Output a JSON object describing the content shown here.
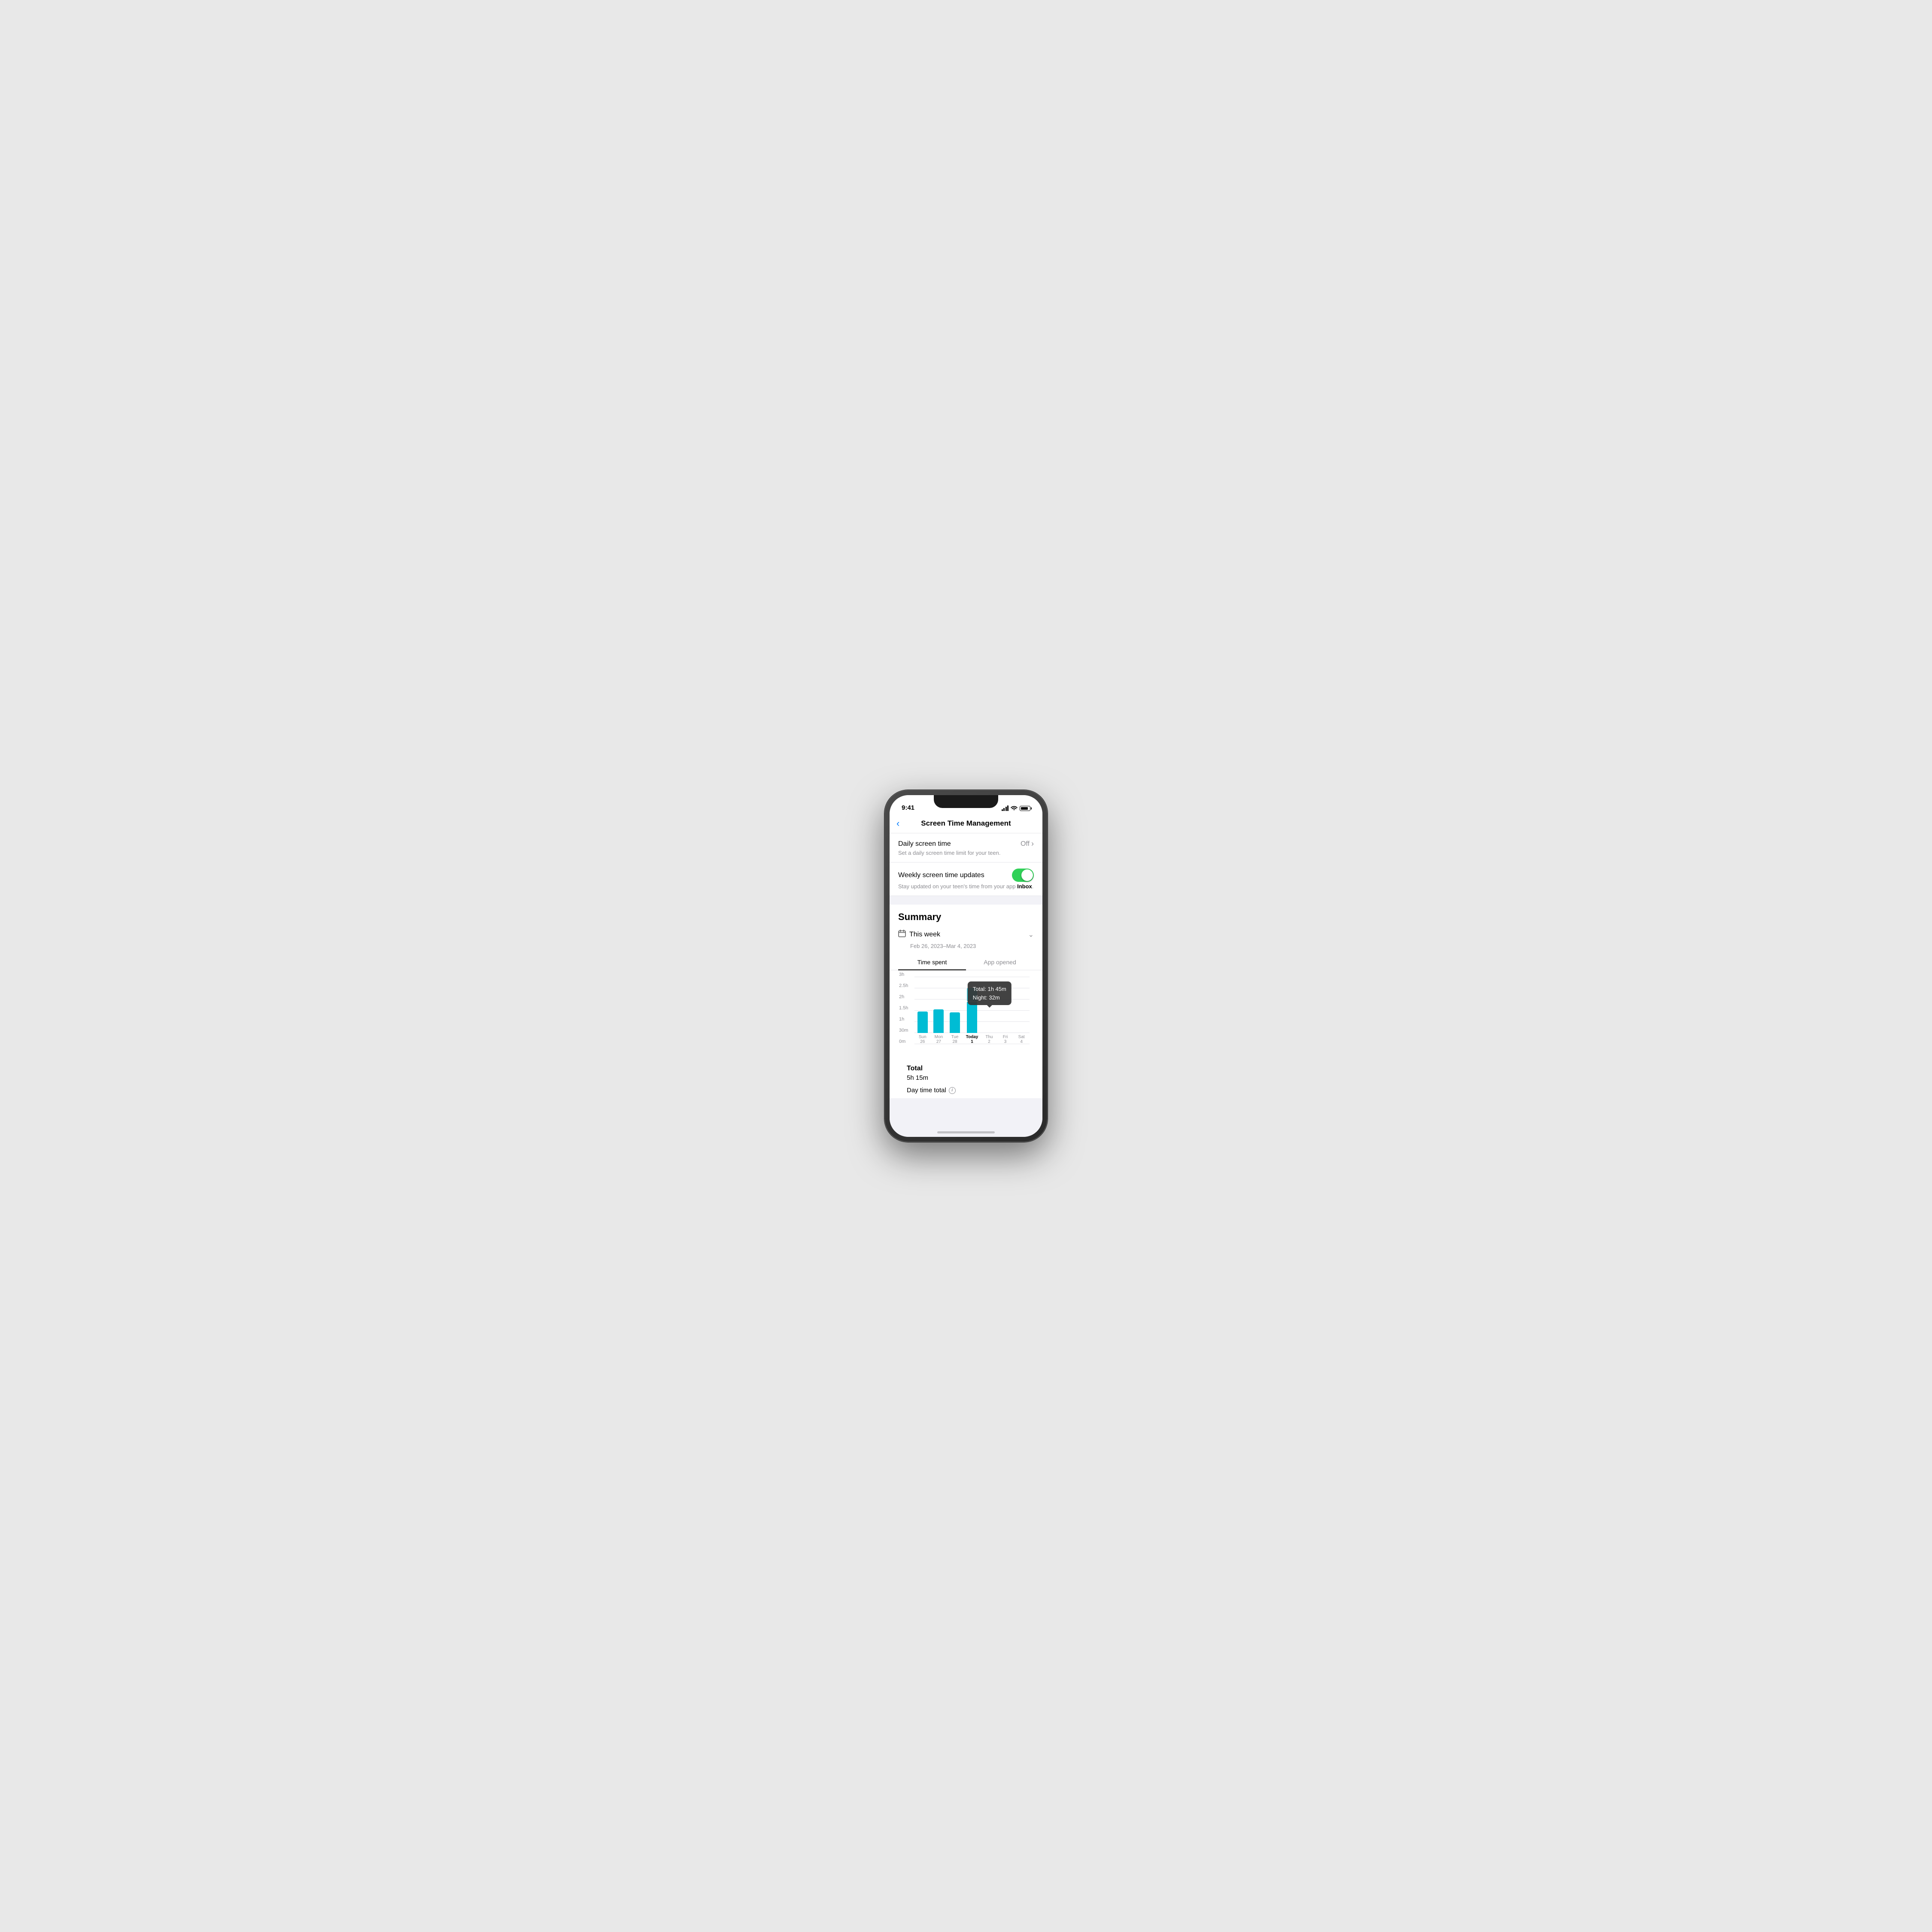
{
  "status": {
    "time": "9:41",
    "signal_bars": [
      4,
      7,
      10,
      13
    ],
    "battery_level": 85
  },
  "nav": {
    "title": "Screen Time Management",
    "back_label": "‹"
  },
  "settings": {
    "daily_screen_time": {
      "title": "Daily screen time",
      "subtitle": "Set a daily screen time limit for your teen.",
      "value": "Off",
      "chevron": "›"
    },
    "weekly_updates": {
      "title": "Weekly screen time updates",
      "subtitle_prefix": "Stay updated on your teen's time from your app ",
      "subtitle_bold": "Inbox",
      "subtitle_suffix": ".",
      "enabled": true
    }
  },
  "summary": {
    "section_title": "Summary",
    "week_selector": {
      "label": "This week",
      "range": "Feb 26, 2023–Mar 4, 2023",
      "chevron": "⌄"
    },
    "tabs": [
      {
        "id": "time_spent",
        "label": "Time spent",
        "active": true
      },
      {
        "id": "app_opened",
        "label": "App opened",
        "active": false
      }
    ],
    "tooltip": {
      "line1": "Total: 1h 45m",
      "line2": "Night: 32m"
    },
    "chart": {
      "y_labels": [
        "3h",
        "2.5h",
        "2h",
        "1.5h",
        "1h",
        "30m",
        "0m"
      ],
      "max_height": 156,
      "bars": [
        {
          "day": "Sun",
          "date": "26",
          "day_height": 50,
          "night_height": 0,
          "today": false
        },
        {
          "day": "Mon",
          "date": "27",
          "day_height": 55,
          "night_height": 0,
          "today": false
        },
        {
          "day": "Tue",
          "date": "28",
          "day_height": 48,
          "night_height": 0,
          "today": false
        },
        {
          "day": "Today",
          "date": "1",
          "day_height": 72,
          "night_height": 32,
          "today": true
        },
        {
          "day": "Thu",
          "date": "2",
          "day_height": 0,
          "night_height": 0,
          "today": false
        },
        {
          "day": "Fri",
          "date": "3",
          "day_height": 0,
          "night_height": 0,
          "today": false
        },
        {
          "day": "Sat",
          "date": "4",
          "day_height": 0,
          "night_height": 0,
          "today": false
        }
      ]
    },
    "totals": {
      "label": "Total",
      "value": "5h 15m",
      "daytime_label": "Day time total"
    }
  }
}
